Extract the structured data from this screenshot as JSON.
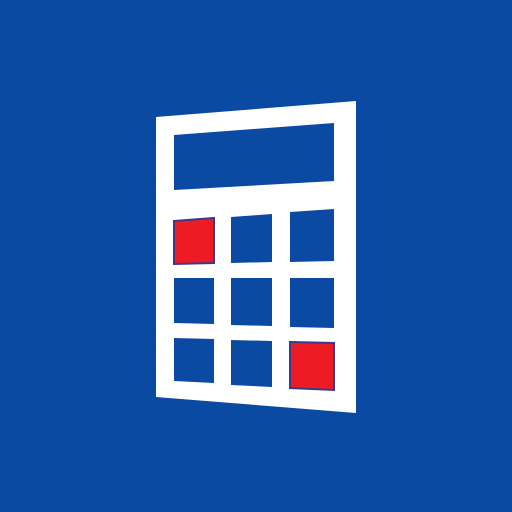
{
  "icon": {
    "name": "calculator-app-icon",
    "symbol": "calculator-icon",
    "colors": {
      "background": "#0b4aa2",
      "body": "#ffffff",
      "display": "#0b4aa2",
      "key": "#0b4aa2",
      "accent_key": "#ed1c24",
      "accent_key_border": "#3b3a8a"
    },
    "keypad": {
      "rows": 3,
      "columns": 3,
      "accent_keys": [
        "top-left",
        "bottom-right"
      ]
    }
  }
}
